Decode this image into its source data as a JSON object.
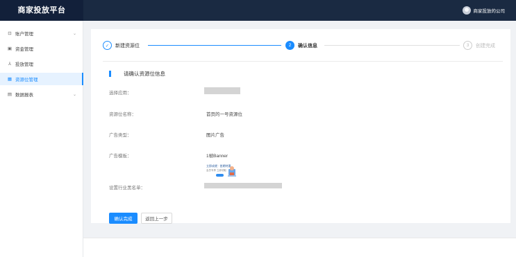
{
  "app": {
    "title": "商家投放平台"
  },
  "user": {
    "company": "商家投放的公司"
  },
  "sidebar": {
    "items": [
      {
        "label": "账户管理",
        "icon": "user-icon",
        "expandable": true,
        "active": false
      },
      {
        "label": "资金管理",
        "icon": "wallet-icon",
        "expandable": false,
        "active": false
      },
      {
        "label": "投放管理",
        "icon": "campaign-icon",
        "expandable": false,
        "active": false
      },
      {
        "label": "资源位管理",
        "icon": "grid-icon",
        "expandable": false,
        "active": true
      },
      {
        "label": "数据报表",
        "icon": "report-icon",
        "expandable": true,
        "active": false
      }
    ]
  },
  "steps": [
    {
      "index": "✓",
      "label": "新建资源位",
      "state": "done"
    },
    {
      "index": "2",
      "label": "确认信息",
      "state": "current"
    },
    {
      "index": "3",
      "label": "创建完成",
      "state": "todo"
    }
  ],
  "section": {
    "title": "请确认资源位信息"
  },
  "fields": {
    "app_label": "选择应用：",
    "name_label": "资源位名称：",
    "name_value": "首页的一号资源位",
    "type_label": "广告类型：",
    "type_value": "图片广告",
    "template_label": "广告模板：",
    "template_value": "1帧Banner",
    "industry_label": "设置行业黑名单："
  },
  "thumbnail": {
    "line1": "立即成就 · 首期特惠",
    "line2": "会员专享 立即领取"
  },
  "buttons": {
    "confirm": "确认完成",
    "back": "返回上一步"
  },
  "colors": {
    "accent": "#1a8cff",
    "topbar": "#1a2a42",
    "brand_bg": "#12203a"
  }
}
